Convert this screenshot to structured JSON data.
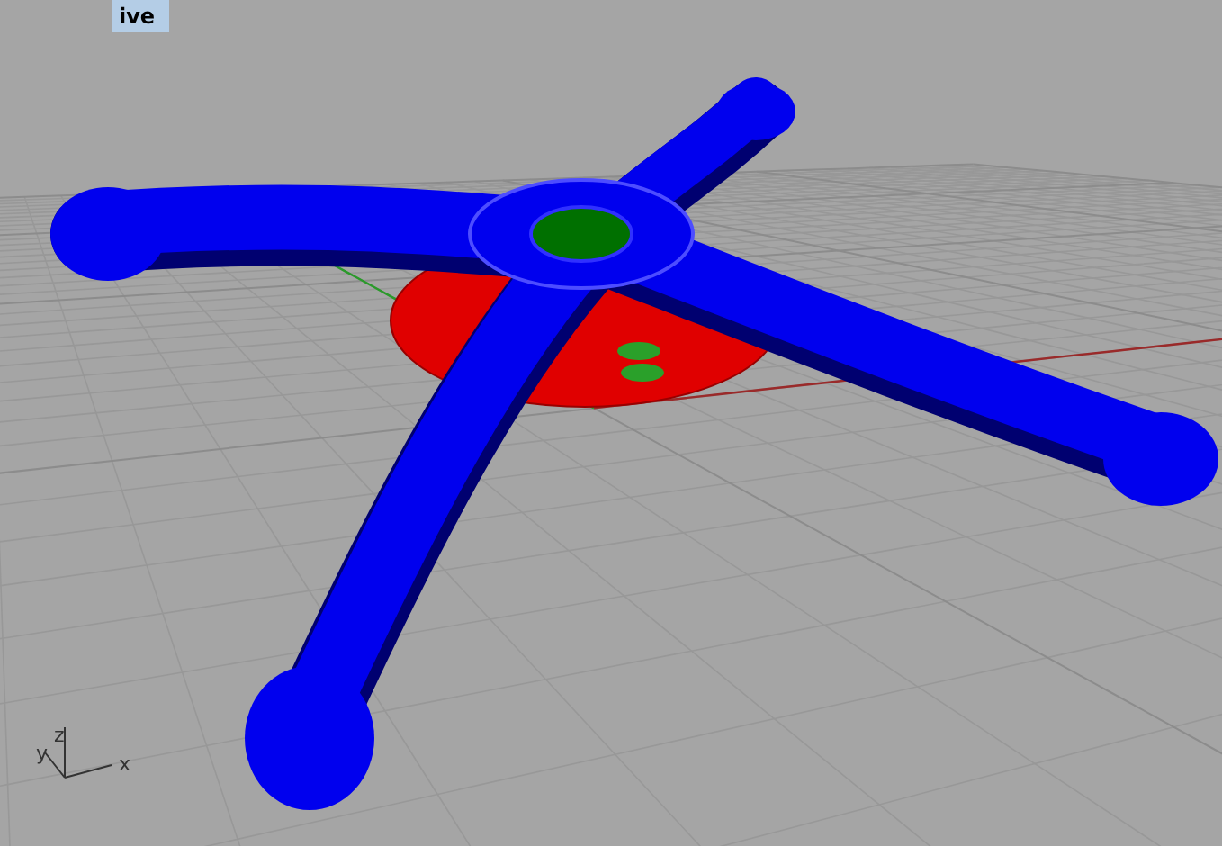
{
  "viewport": {
    "title": "ive"
  },
  "axis_icon": {
    "labels": [
      {
        "kind": "z",
        "text": "z"
      },
      {
        "kind": "y",
        "text": "y"
      },
      {
        "kind": "x",
        "text": "x"
      }
    ]
  }
}
